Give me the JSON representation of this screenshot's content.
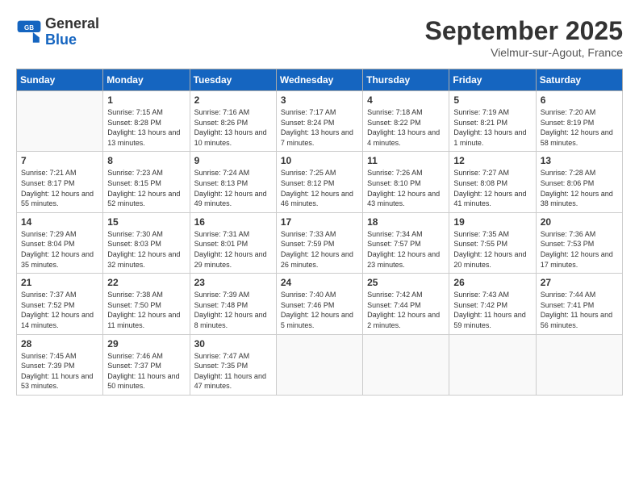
{
  "logo": {
    "general": "General",
    "blue": "Blue"
  },
  "title": "September 2025",
  "subtitle": "Vielmur-sur-Agout, France",
  "weekdays": [
    "Sunday",
    "Monday",
    "Tuesday",
    "Wednesday",
    "Thursday",
    "Friday",
    "Saturday"
  ],
  "weeks": [
    [
      {
        "day": "",
        "sunrise": "",
        "sunset": "",
        "daylight": ""
      },
      {
        "day": "1",
        "sunrise": "Sunrise: 7:15 AM",
        "sunset": "Sunset: 8:28 PM",
        "daylight": "Daylight: 13 hours and 13 minutes."
      },
      {
        "day": "2",
        "sunrise": "Sunrise: 7:16 AM",
        "sunset": "Sunset: 8:26 PM",
        "daylight": "Daylight: 13 hours and 10 minutes."
      },
      {
        "day": "3",
        "sunrise": "Sunrise: 7:17 AM",
        "sunset": "Sunset: 8:24 PM",
        "daylight": "Daylight: 13 hours and 7 minutes."
      },
      {
        "day": "4",
        "sunrise": "Sunrise: 7:18 AM",
        "sunset": "Sunset: 8:22 PM",
        "daylight": "Daylight: 13 hours and 4 minutes."
      },
      {
        "day": "5",
        "sunrise": "Sunrise: 7:19 AM",
        "sunset": "Sunset: 8:21 PM",
        "daylight": "Daylight: 13 hours and 1 minute."
      },
      {
        "day": "6",
        "sunrise": "Sunrise: 7:20 AM",
        "sunset": "Sunset: 8:19 PM",
        "daylight": "Daylight: 12 hours and 58 minutes."
      }
    ],
    [
      {
        "day": "7",
        "sunrise": "Sunrise: 7:21 AM",
        "sunset": "Sunset: 8:17 PM",
        "daylight": "Daylight: 12 hours and 55 minutes."
      },
      {
        "day": "8",
        "sunrise": "Sunrise: 7:23 AM",
        "sunset": "Sunset: 8:15 PM",
        "daylight": "Daylight: 12 hours and 52 minutes."
      },
      {
        "day": "9",
        "sunrise": "Sunrise: 7:24 AM",
        "sunset": "Sunset: 8:13 PM",
        "daylight": "Daylight: 12 hours and 49 minutes."
      },
      {
        "day": "10",
        "sunrise": "Sunrise: 7:25 AM",
        "sunset": "Sunset: 8:12 PM",
        "daylight": "Daylight: 12 hours and 46 minutes."
      },
      {
        "day": "11",
        "sunrise": "Sunrise: 7:26 AM",
        "sunset": "Sunset: 8:10 PM",
        "daylight": "Daylight: 12 hours and 43 minutes."
      },
      {
        "day": "12",
        "sunrise": "Sunrise: 7:27 AM",
        "sunset": "Sunset: 8:08 PM",
        "daylight": "Daylight: 12 hours and 41 minutes."
      },
      {
        "day": "13",
        "sunrise": "Sunrise: 7:28 AM",
        "sunset": "Sunset: 8:06 PM",
        "daylight": "Daylight: 12 hours and 38 minutes."
      }
    ],
    [
      {
        "day": "14",
        "sunrise": "Sunrise: 7:29 AM",
        "sunset": "Sunset: 8:04 PM",
        "daylight": "Daylight: 12 hours and 35 minutes."
      },
      {
        "day": "15",
        "sunrise": "Sunrise: 7:30 AM",
        "sunset": "Sunset: 8:03 PM",
        "daylight": "Daylight: 12 hours and 32 minutes."
      },
      {
        "day": "16",
        "sunrise": "Sunrise: 7:31 AM",
        "sunset": "Sunset: 8:01 PM",
        "daylight": "Daylight: 12 hours and 29 minutes."
      },
      {
        "day": "17",
        "sunrise": "Sunrise: 7:33 AM",
        "sunset": "Sunset: 7:59 PM",
        "daylight": "Daylight: 12 hours and 26 minutes."
      },
      {
        "day": "18",
        "sunrise": "Sunrise: 7:34 AM",
        "sunset": "Sunset: 7:57 PM",
        "daylight": "Daylight: 12 hours and 23 minutes."
      },
      {
        "day": "19",
        "sunrise": "Sunrise: 7:35 AM",
        "sunset": "Sunset: 7:55 PM",
        "daylight": "Daylight: 12 hours and 20 minutes."
      },
      {
        "day": "20",
        "sunrise": "Sunrise: 7:36 AM",
        "sunset": "Sunset: 7:53 PM",
        "daylight": "Daylight: 12 hours and 17 minutes."
      }
    ],
    [
      {
        "day": "21",
        "sunrise": "Sunrise: 7:37 AM",
        "sunset": "Sunset: 7:52 PM",
        "daylight": "Daylight: 12 hours and 14 minutes."
      },
      {
        "day": "22",
        "sunrise": "Sunrise: 7:38 AM",
        "sunset": "Sunset: 7:50 PM",
        "daylight": "Daylight: 12 hours and 11 minutes."
      },
      {
        "day": "23",
        "sunrise": "Sunrise: 7:39 AM",
        "sunset": "Sunset: 7:48 PM",
        "daylight": "Daylight: 12 hours and 8 minutes."
      },
      {
        "day": "24",
        "sunrise": "Sunrise: 7:40 AM",
        "sunset": "Sunset: 7:46 PM",
        "daylight": "Daylight: 12 hours and 5 minutes."
      },
      {
        "day": "25",
        "sunrise": "Sunrise: 7:42 AM",
        "sunset": "Sunset: 7:44 PM",
        "daylight": "Daylight: 12 hours and 2 minutes."
      },
      {
        "day": "26",
        "sunrise": "Sunrise: 7:43 AM",
        "sunset": "Sunset: 7:42 PM",
        "daylight": "Daylight: 11 hours and 59 minutes."
      },
      {
        "day": "27",
        "sunrise": "Sunrise: 7:44 AM",
        "sunset": "Sunset: 7:41 PM",
        "daylight": "Daylight: 11 hours and 56 minutes."
      }
    ],
    [
      {
        "day": "28",
        "sunrise": "Sunrise: 7:45 AM",
        "sunset": "Sunset: 7:39 PM",
        "daylight": "Daylight: 11 hours and 53 minutes."
      },
      {
        "day": "29",
        "sunrise": "Sunrise: 7:46 AM",
        "sunset": "Sunset: 7:37 PM",
        "daylight": "Daylight: 11 hours and 50 minutes."
      },
      {
        "day": "30",
        "sunrise": "Sunrise: 7:47 AM",
        "sunset": "Sunset: 7:35 PM",
        "daylight": "Daylight: 11 hours and 47 minutes."
      },
      {
        "day": "",
        "sunrise": "",
        "sunset": "",
        "daylight": ""
      },
      {
        "day": "",
        "sunrise": "",
        "sunset": "",
        "daylight": ""
      },
      {
        "day": "",
        "sunrise": "",
        "sunset": "",
        "daylight": ""
      },
      {
        "day": "",
        "sunrise": "",
        "sunset": "",
        "daylight": ""
      }
    ]
  ]
}
